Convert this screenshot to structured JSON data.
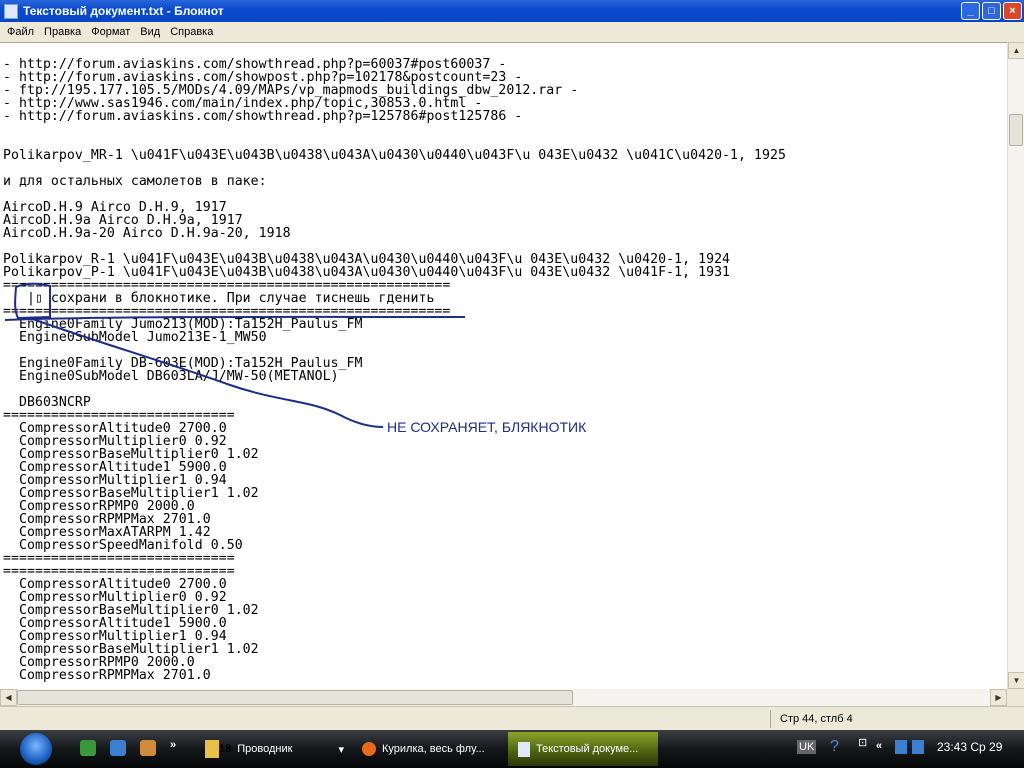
{
  "window": {
    "title": "Текстовый документ.txt - Блокнот",
    "buttons": [
      "_",
      "□",
      "×"
    ]
  },
  "menu": [
    "Файл",
    "Правка",
    "Формат",
    "Вид",
    "Справка"
  ],
  "lines": [
    "- http://forum.aviaskins.com/showthread.php?p=60037#post60037 -",
    "- http://forum.aviaskins.com/showpost.php?p=102178&postcount=23 -",
    "- ftp://195.177.105.5/MODs/4.09/MAPs/vp_mapmods_buildings_dbw_2012.rar -",
    "- http://www.sas1946.com/main/index.php/topic,30853.0.html -",
    "- http://forum.aviaskins.com/showthread.php?p=125786#post125786 -",
    "",
    "",
    "Polikarpov_MR-1 \\u041F\\u043E\\u043B\\u0438\\u043A\\u0430\\u0440\\u043F\\u 043E\\u0432 \\u041C\\u0420-1, 1925",
    "",
    "и для остальных самолетов в паке:",
    "",
    "AircoD.H.9 Airco D.H.9, 1917",
    "AircoD.H.9a Airco D.H.9a, 1917",
    "AircoD.H.9a-20 Airco D.H.9a-20, 1918",
    "",
    "Polikarpov_R-1 \\u041F\\u043E\\u043B\\u0438\\u043A\\u0430\\u0440\\u043F\\u 043E\\u0432 \\u0420-1, 1924",
    "Polikarpov_P-1 \\u041F\\u043E\\u043B\\u0438\\u043A\\u0430\\u0440\\u043F\\u 043E\\u0432 \\u041F-1, 1931",
    "========================================================",
    "   |▯ сохрани в блокнотике. При случае тиснешь гденить",
    "========================================================",
    "  Engine0Family Jumo213(MOD):Ta152H_Paulus_FM",
    "  Engine0SubModel Jumo213E-1_MW50",
    "",
    "  Engine0Family DB-603E(MOD):Ta152H_Paulus_FM",
    "  Engine0SubModel DB603LA/J/MW-50(METANOL)",
    "",
    "  DB603NCRP",
    "=============================",
    "  CompressorAltitude0 2700.0",
    "  CompressorMultiplier0 0.92",
    "  CompressorBaseMultiplier0 1.02",
    "  CompressorAltitude1 5900.0",
    "  CompressorMultiplier1 0.94",
    "  CompressorBaseMultiplier1 1.02",
    "  CompressorRPMP0 2000.0",
    "  CompressorRPMPMax 2701.0",
    "  CompressorMaxATARPM 1.42",
    "  CompressorSpeedManifold 0.50",
    "=============================",
    "=============================",
    "  CompressorAltitude0 2700.0",
    "  CompressorMultiplier0 0.92",
    "  CompressorBaseMultiplier0 1.02",
    "  CompressorAltitude1 5900.0",
    "  CompressorMultiplier1 0.94",
    "  CompressorBaseMultiplier1 1.02",
    "  CompressorRPMP0 2000.0",
    "  CompressorRPMPMax 2701.0"
  ],
  "annotation": {
    "text": "НЕ СОХРАНЯЕТ, БЛЯКНОТИК",
    "color": "#1c2d8a"
  },
  "status": {
    "position": "Стр 44, стлб 4"
  },
  "taskbar": {
    "tasks": [
      {
        "label": "Проводник",
        "count": "18"
      },
      {
        "label": "Курилка, весь флу..."
      },
      {
        "label": "Текстовый докуме..."
      }
    ],
    "lang": "UK",
    "help": "?",
    "clock": "23:43 Ср 29"
  }
}
